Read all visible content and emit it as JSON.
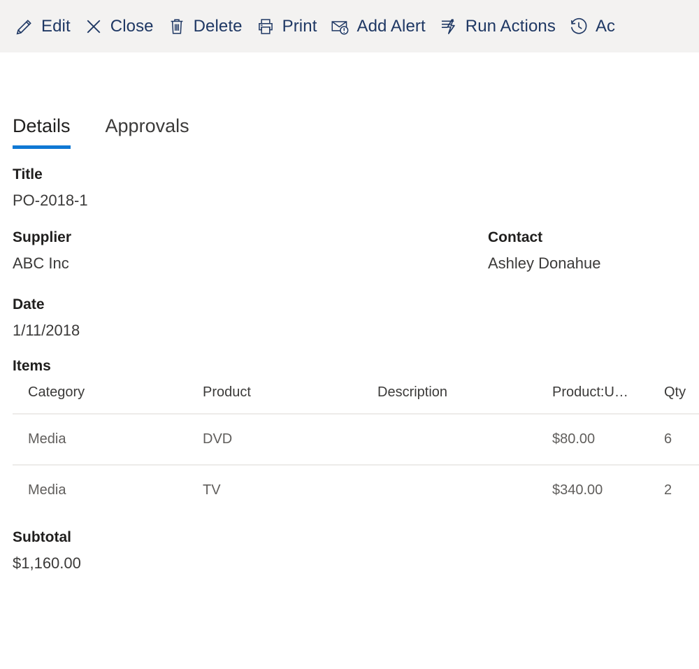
{
  "commandbar": {
    "items": [
      {
        "label": "Edit",
        "icon": "pencil-icon"
      },
      {
        "label": "Close",
        "icon": "close-x-icon"
      },
      {
        "label": "Delete",
        "icon": "trash-icon"
      },
      {
        "label": "Print",
        "icon": "printer-icon"
      },
      {
        "label": "Add Alert",
        "icon": "alert-envelope-icon"
      },
      {
        "label": "Run Actions",
        "icon": "lightning-bolt-icon"
      },
      {
        "label": "Ac",
        "icon": "history-clock-icon"
      }
    ]
  },
  "tabs": [
    {
      "label": "Details",
      "active": true
    },
    {
      "label": "Approvals",
      "active": false
    }
  ],
  "form": {
    "title": {
      "label": "Title",
      "value": "PO-2018-1"
    },
    "supplier": {
      "label": "Supplier",
      "value": "ABC Inc"
    },
    "contact": {
      "label": "Contact",
      "value": "Ashley Donahue"
    },
    "date": {
      "label": "Date",
      "value": "1/11/2018"
    },
    "items": {
      "label": "Items"
    },
    "subtotal": {
      "label": "Subtotal",
      "value": "$1,160.00"
    }
  },
  "items_table": {
    "columns": [
      "Category",
      "Product",
      "Description",
      "Product:U…",
      "Qty"
    ],
    "rows": [
      {
        "category": "Media",
        "product": "DVD",
        "description": "",
        "unit_price": "$80.00",
        "qty": "6"
      },
      {
        "category": "Media",
        "product": "TV",
        "description": "",
        "unit_price": "$340.00",
        "qty": "2"
      }
    ]
  },
  "colors": {
    "accent": "#0f78d4",
    "commandbar_bg": "#f3f2f1",
    "command_text": "#1f3864",
    "label_text": "#201f1e",
    "value_text": "#3b3a39",
    "table_text": "#605e5c",
    "divider": "#edebe9"
  }
}
